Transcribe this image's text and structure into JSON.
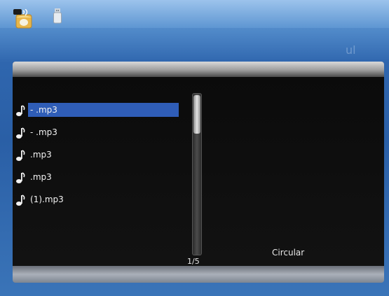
{
  "status_bar": {
    "app_icon": "music-folder-icon",
    "device_icon": "usb-icon",
    "faint_mark": "ul"
  },
  "file_list": {
    "items": [
      {
        "label": "- .mp3",
        "icon": "music-note-icon",
        "selected": true
      },
      {
        "label": "- .mp3",
        "icon": "music-note-icon",
        "selected": false
      },
      {
        "label": ".mp3",
        "icon": "music-note-icon",
        "selected": false
      },
      {
        "label": ".mp3",
        "icon": "music-note-icon",
        "selected": false
      },
      {
        "label": "(1).mp3",
        "icon": "music-note-icon",
        "selected": false
      }
    ]
  },
  "pagination": {
    "page": "1/5"
  },
  "play_mode": {
    "label": "Circular"
  },
  "colors": {
    "selection": "#2f5db7",
    "panel": "#0c0c0c",
    "background": "#2f66ae"
  }
}
